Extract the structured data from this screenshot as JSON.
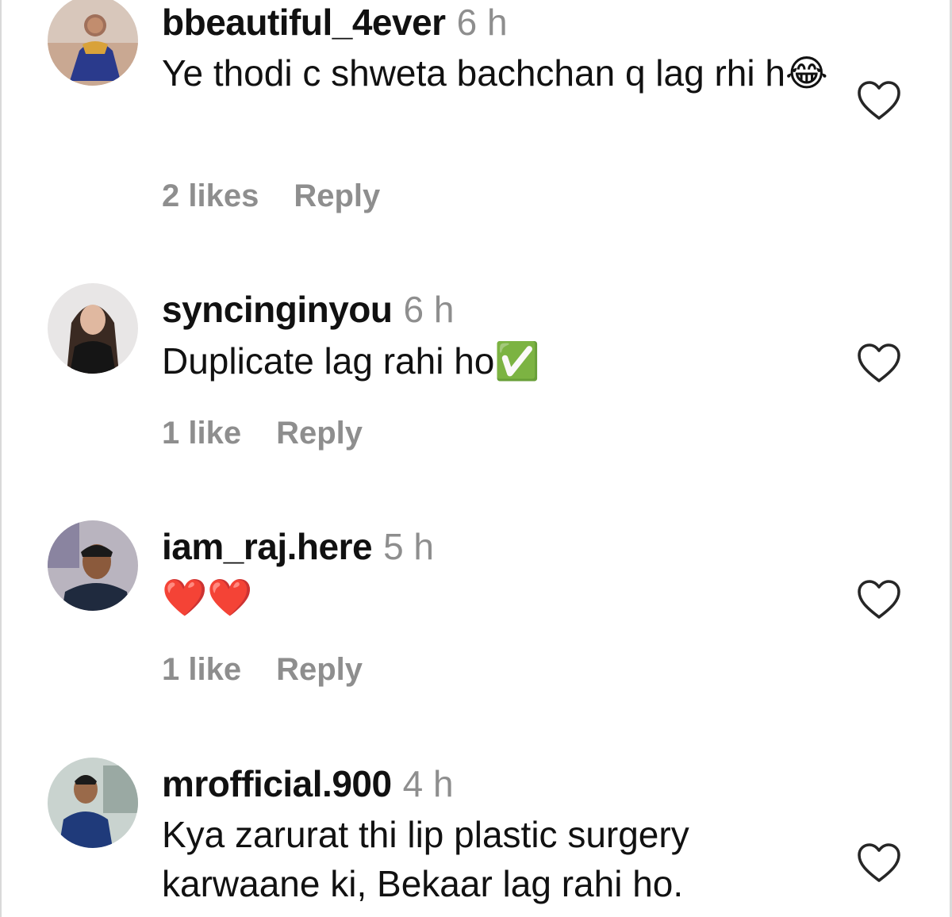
{
  "comments": [
    {
      "username": "bbeautiful_4ever",
      "time": "6 h",
      "text": "Ye thodi c shweta bachchan q lag rhi h😂",
      "likes": "2 likes",
      "reply": "Reply",
      "avatar_icon": "profile-photo"
    },
    {
      "username": "syncinginyou",
      "time": "6 h",
      "text": "Duplicate lag rahi ho✅",
      "likes": "1 like",
      "reply": "Reply",
      "avatar_icon": "profile-photo"
    },
    {
      "username": "iam_raj.here",
      "time": "5 h",
      "text": "❤️❤️",
      "likes": "1 like",
      "reply": "Reply",
      "avatar_icon": "profile-photo"
    },
    {
      "username": "mrofficial.900",
      "time": "4 h",
      "text": "Kya zarurat thi lip plastic surgery karwaane ki, Bekaar lag rahi ho.",
      "avatar_icon": "profile-photo"
    }
  ],
  "colors": {
    "text": "#111111",
    "muted": "#8e8e8e",
    "background": "#ffffff"
  },
  "icons": {
    "like": "heart-outline-icon"
  }
}
